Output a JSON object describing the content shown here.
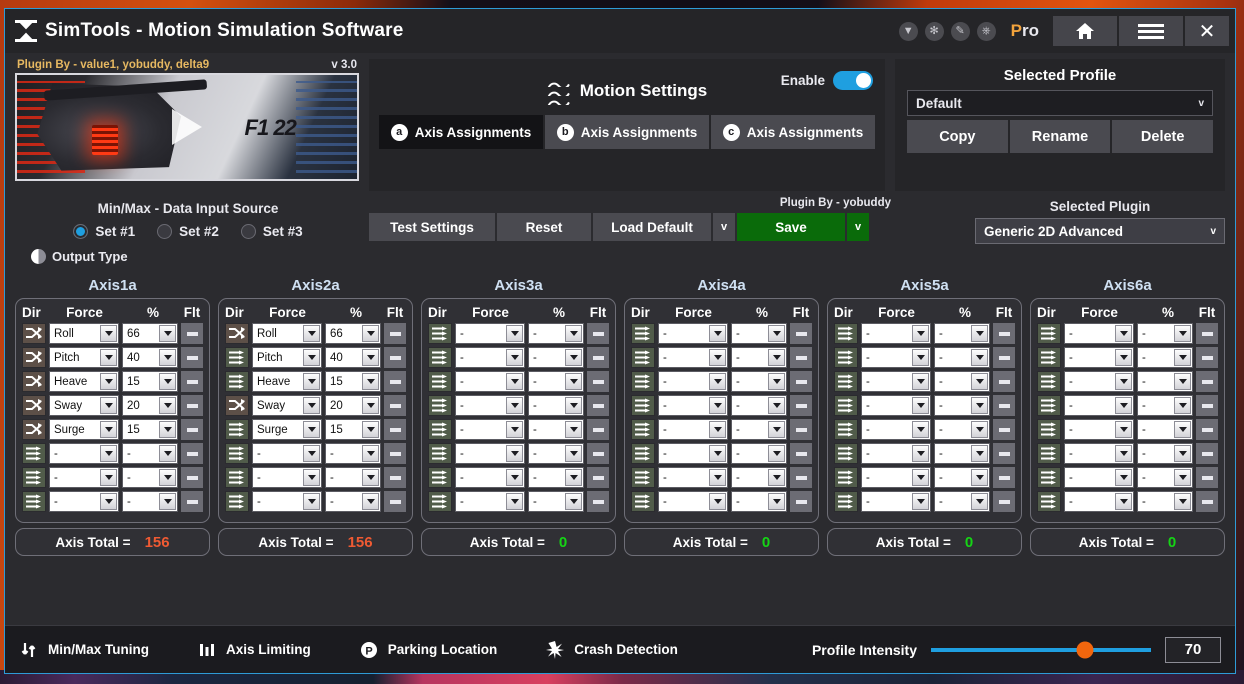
{
  "titlebar": {
    "app_title": "SimTools - Motion Simulation Software",
    "logo_icon": "simtools-logo-icon",
    "icons": [
      {
        "name": "download-icon",
        "glyph": "⬇"
      },
      {
        "name": "burst-icon",
        "glyph": "✻"
      },
      {
        "name": "pencil-icon",
        "glyph": "✐"
      },
      {
        "name": "power-icon",
        "glyph": "⏻"
      }
    ],
    "pro_label_1": "P",
    "pro_label_2": "ro",
    "home_icon": "home-icon",
    "menu_icon": "hamburger-menu-icon",
    "close_icon": "close-icon",
    "close_glyph": "✕"
  },
  "video": {
    "plugin_by": "Plugin By - value1, yobuddy, delta9",
    "version": "v 3.0",
    "game_logo": "F1 22",
    "play_icon": "play-button-icon"
  },
  "motion": {
    "title": "Motion Settings",
    "wave_icon": "wave-motion-icon",
    "enable_label": "Enable",
    "enable_on": true,
    "tabs": [
      {
        "badge": "a",
        "label": "Axis Assignments",
        "active": true
      },
      {
        "badge": "b",
        "label": "Axis Assignments",
        "active": false
      },
      {
        "badge": "c",
        "label": "Axis Assignments",
        "active": false
      }
    ]
  },
  "profile": {
    "title": "Selected Profile",
    "selected": "Default",
    "caret": "v",
    "copy": "Copy",
    "rename": "Rename",
    "delete": "Delete"
  },
  "minmax": {
    "title": "Min/Max - Data Input Source",
    "sets": [
      {
        "label": "Set #1",
        "selected": true
      },
      {
        "label": "Set #2",
        "selected": false
      },
      {
        "label": "Set #3",
        "selected": false
      }
    ],
    "output_type": "Output Type",
    "output_icon": "half-circle-icon"
  },
  "toolbar": {
    "plugin_by": "Plugin By - yobuddy",
    "test_settings": "Test Settings",
    "reset": "Reset",
    "load_default": "Load Default",
    "load_caret": "v",
    "save": "Save",
    "save_caret": "v",
    "save_color": "#0a6b0a"
  },
  "plugin": {
    "title": "Selected Plugin",
    "selected": "Generic 2D Advanced",
    "caret": "v"
  },
  "axis_table": {
    "headers": {
      "dir": "Dir",
      "force": "Force",
      "pct": "%",
      "flt": "Flt"
    },
    "total_label": "Axis Total =",
    "total_color_active": "#ef5a33",
    "total_color_zero": "#15d415",
    "empty_value": "-"
  },
  "axes": [
    {
      "name": "Axis1a",
      "total": "156",
      "total_active": true,
      "rows": [
        {
          "dir": "crossed",
          "force": "Roll",
          "pct": "66"
        },
        {
          "dir": "crossed",
          "force": "Pitch",
          "pct": "40"
        },
        {
          "dir": "crossed",
          "force": "Heave",
          "pct": "15"
        },
        {
          "dir": "crossed",
          "force": "Sway",
          "pct": "20"
        },
        {
          "dir": "crossed",
          "force": "Surge",
          "pct": "15"
        },
        {
          "dir": "parallel",
          "force": "-",
          "pct": "-"
        },
        {
          "dir": "parallel",
          "force": "-",
          "pct": "-"
        },
        {
          "dir": "parallel",
          "force": "-",
          "pct": "-"
        }
      ]
    },
    {
      "name": "Axis2a",
      "total": "156",
      "total_active": true,
      "rows": [
        {
          "dir": "crossed",
          "force": "Roll",
          "pct": "66"
        },
        {
          "dir": "parallel",
          "force": "Pitch",
          "pct": "40"
        },
        {
          "dir": "parallel",
          "force": "Heave",
          "pct": "15"
        },
        {
          "dir": "crossed",
          "force": "Sway",
          "pct": "20"
        },
        {
          "dir": "parallel",
          "force": "Surge",
          "pct": "15"
        },
        {
          "dir": "parallel",
          "force": "-",
          "pct": "-"
        },
        {
          "dir": "parallel",
          "force": "-",
          "pct": "-"
        },
        {
          "dir": "parallel",
          "force": "-",
          "pct": "-"
        }
      ]
    },
    {
      "name": "Axis3a",
      "total": "0",
      "total_active": false,
      "rows": [
        {
          "dir": "parallel",
          "force": "-",
          "pct": "-"
        },
        {
          "dir": "parallel",
          "force": "-",
          "pct": "-"
        },
        {
          "dir": "parallel",
          "force": "-",
          "pct": "-"
        },
        {
          "dir": "parallel",
          "force": "-",
          "pct": "-"
        },
        {
          "dir": "parallel",
          "force": "-",
          "pct": "-"
        },
        {
          "dir": "parallel",
          "force": "-",
          "pct": "-"
        },
        {
          "dir": "parallel",
          "force": "-",
          "pct": "-"
        },
        {
          "dir": "parallel",
          "force": "-",
          "pct": "-"
        }
      ]
    },
    {
      "name": "Axis4a",
      "total": "0",
      "total_active": false,
      "rows": [
        {
          "dir": "parallel",
          "force": "-",
          "pct": "-"
        },
        {
          "dir": "parallel",
          "force": "-",
          "pct": "-"
        },
        {
          "dir": "parallel",
          "force": "-",
          "pct": "-"
        },
        {
          "dir": "parallel",
          "force": "-",
          "pct": "-"
        },
        {
          "dir": "parallel",
          "force": "-",
          "pct": "-"
        },
        {
          "dir": "parallel",
          "force": "-",
          "pct": "-"
        },
        {
          "dir": "parallel",
          "force": "-",
          "pct": "-"
        },
        {
          "dir": "parallel",
          "force": "-",
          "pct": "-"
        }
      ]
    },
    {
      "name": "Axis5a",
      "total": "0",
      "total_active": false,
      "rows": [
        {
          "dir": "parallel",
          "force": "-",
          "pct": "-"
        },
        {
          "dir": "parallel",
          "force": "-",
          "pct": "-"
        },
        {
          "dir": "parallel",
          "force": "-",
          "pct": "-"
        },
        {
          "dir": "parallel",
          "force": "-",
          "pct": "-"
        },
        {
          "dir": "parallel",
          "force": "-",
          "pct": "-"
        },
        {
          "dir": "parallel",
          "force": "-",
          "pct": "-"
        },
        {
          "dir": "parallel",
          "force": "-",
          "pct": "-"
        },
        {
          "dir": "parallel",
          "force": "-",
          "pct": "-"
        }
      ]
    },
    {
      "name": "Axis6a",
      "total": "0",
      "total_active": false,
      "rows": [
        {
          "dir": "parallel",
          "force": "-",
          "pct": "-"
        },
        {
          "dir": "parallel",
          "force": "-",
          "pct": "-"
        },
        {
          "dir": "parallel",
          "force": "-",
          "pct": "-"
        },
        {
          "dir": "parallel",
          "force": "-",
          "pct": "-"
        },
        {
          "dir": "parallel",
          "force": "-",
          "pct": "-"
        },
        {
          "dir": "parallel",
          "force": "-",
          "pct": "-"
        },
        {
          "dir": "parallel",
          "force": "-",
          "pct": "-"
        },
        {
          "dir": "parallel",
          "force": "-",
          "pct": "-"
        }
      ]
    }
  ],
  "bottombar": {
    "items": [
      {
        "icon": "min-max-arrows-icon",
        "label": "Min/Max Tuning"
      },
      {
        "icon": "bar-levels-icon",
        "label": "Axis Limiting"
      },
      {
        "icon": "parking-p-icon",
        "label": "Parking Location"
      },
      {
        "icon": "crash-burst-icon",
        "label": "Crash Detection"
      }
    ],
    "intensity_label": "Profile Intensity",
    "intensity_value": "70",
    "intensity_percent": 70,
    "track_color": "#1f9fe0",
    "thumb_color": "#f2660d"
  }
}
